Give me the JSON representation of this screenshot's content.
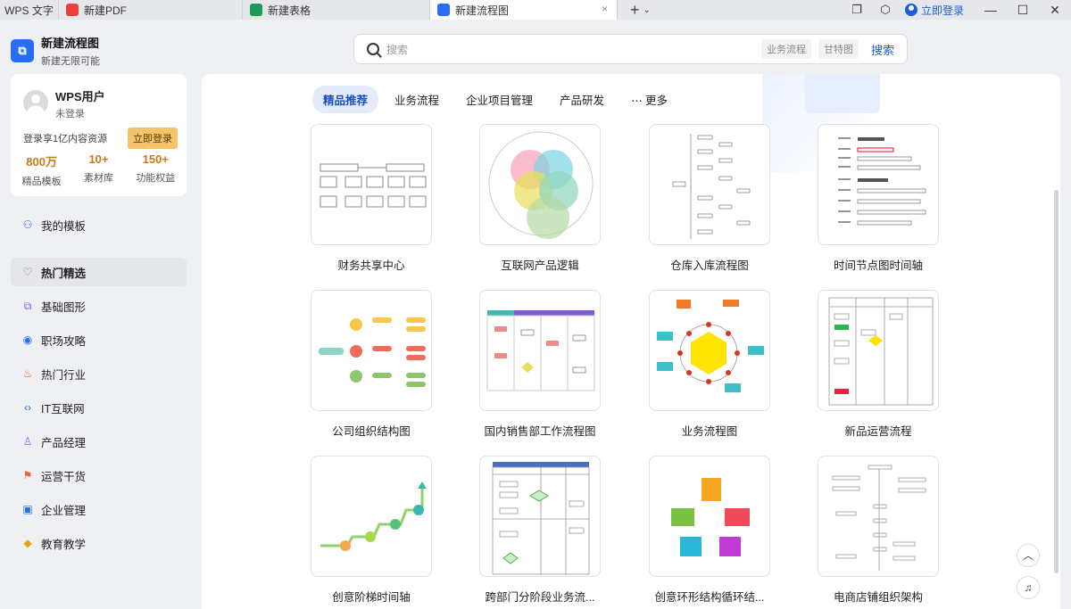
{
  "tabs": [
    {
      "label": "WPS 文字",
      "active": false
    },
    {
      "label": "新建PDF",
      "icon_color": "#e8413c",
      "active": false
    },
    {
      "label": "新建表格",
      "icon_color": "#1e9a5a",
      "active": false
    },
    {
      "label": "新建流程图",
      "icon_color": "#2a6df2",
      "active": true
    }
  ],
  "titlebar": {
    "login_label": "立即登录",
    "close_icon": "×",
    "plus": "+",
    "plus_menu": "⌄"
  },
  "app": {
    "title": "新建流程图",
    "subtitle": "新建无限可能"
  },
  "search": {
    "placeholder": "搜索",
    "chips": [
      "业务流程",
      "甘特图"
    ],
    "button": "搜索"
  },
  "user": {
    "name": "WPS用户",
    "status": "未登录",
    "message": "登录享1亿内容资源",
    "login_button": "立即登录",
    "stats": [
      {
        "value": "800万",
        "label": "精品模板"
      },
      {
        "value": "10+",
        "label": "素材库"
      },
      {
        "value": "150+",
        "label": "功能权益"
      }
    ]
  },
  "nav": {
    "top": {
      "label": "我的模板",
      "icon": "user-icon"
    },
    "items": [
      {
        "label": "热门精选",
        "icon": "heart-icon",
        "active": true,
        "color": "#e8413c"
      },
      {
        "label": "基础图形",
        "icon": "shapes-icon",
        "color": "#8a5cf0"
      },
      {
        "label": "职场攻略",
        "icon": "person-circle-icon",
        "color": "#2a6df2"
      },
      {
        "label": "热门行业",
        "icon": "flame-icon",
        "color": "#f0612a"
      },
      {
        "label": "IT互联网",
        "icon": "code-icon",
        "color": "#2a6df2"
      },
      {
        "label": "产品经理",
        "icon": "person-icon",
        "color": "#8a5cf0"
      },
      {
        "label": "运营干货",
        "icon": "megaphone-icon",
        "color": "#f0612a"
      },
      {
        "label": "企业管理",
        "icon": "chat-icon",
        "color": "#2a6df2"
      },
      {
        "label": "教育教学",
        "icon": "graduation-icon",
        "color": "#e8a21a"
      }
    ]
  },
  "categories": [
    {
      "label": "精品推荐",
      "active": true
    },
    {
      "label": "业务流程"
    },
    {
      "label": "企业项目管理"
    },
    {
      "label": "产品研发"
    },
    {
      "label": "更多",
      "icon": "more-icon"
    }
  ],
  "templates": [
    {
      "title": "财务共享中心",
      "kind": "flow"
    },
    {
      "title": "互联网产品逻辑",
      "kind": "venn"
    },
    {
      "title": "仓库入库流程图",
      "kind": "tree"
    },
    {
      "title": "时间节点图时间轴",
      "kind": "gantt"
    },
    {
      "title": "公司组织结构图",
      "kind": "org"
    },
    {
      "title": "国内销售部工作流程图",
      "kind": "swim"
    },
    {
      "title": "业务流程图",
      "kind": "cycle"
    },
    {
      "title": "新品运营流程",
      "kind": "swim2"
    },
    {
      "title": "创意阶梯时间轴",
      "kind": "stairs"
    },
    {
      "title": "跨部门分阶段业务流...",
      "kind": "swim3"
    },
    {
      "title": "创意环形结构循环结...",
      "kind": "star"
    },
    {
      "title": "电商店铺组织架构",
      "kind": "tree2"
    }
  ],
  "fab": {
    "top": "︿",
    "support": "♫"
  }
}
